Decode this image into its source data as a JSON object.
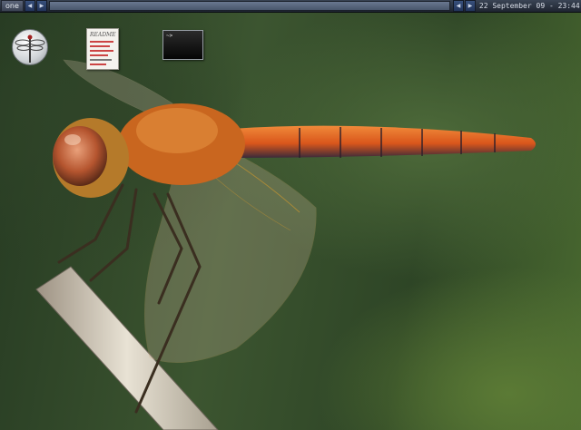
{
  "panel": {
    "workspace_label": "one",
    "clock_text": "22 September 09 - 23:44"
  },
  "icons": {
    "prev": "◀",
    "next": "▶",
    "terminal_prompt": "~>"
  },
  "desktop_icons": {
    "readme_title": "README"
  },
  "colors": {
    "panel": "#2a3140",
    "accent": "#2a3d66",
    "wallpaper_green": "#3c5530",
    "dragonfly_orange": "#e36a1c"
  }
}
